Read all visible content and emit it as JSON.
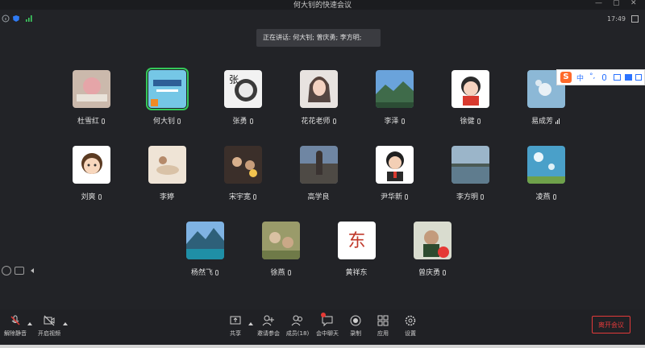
{
  "window": {
    "title": "何大钊的快速会议"
  },
  "topbar": {
    "time": "17:49"
  },
  "speaking": {
    "text": "正在讲话: 何大钊; 曾庆勇; 李方明;"
  },
  "ime": {
    "logo": "S",
    "mode": "中",
    "punct": "°,"
  },
  "participants": [
    {
      "name": "杜雪红"
    },
    {
      "name": "何大钊"
    },
    {
      "name": "张勇"
    },
    {
      "name": "花花老师"
    },
    {
      "name": "李泽"
    },
    {
      "name": "徐健"
    },
    {
      "name": "易成芳"
    },
    {
      "name": "刘爽"
    },
    {
      "name": "李婷"
    },
    {
      "name": "宋宇宽"
    },
    {
      "name": "高学良"
    },
    {
      "name": "尹华新"
    },
    {
      "name": "李方明"
    },
    {
      "name": "凌燕"
    },
    {
      "name": "杨然飞"
    },
    {
      "name": "徐燕"
    },
    {
      "name": "黄祥东"
    },
    {
      "name": "曾庆勇"
    }
  ],
  "avatars": {
    "zhang_char": "张",
    "huang_char": "东"
  },
  "toolbar": {
    "unmute": "解除静音",
    "video": "开启视频",
    "share": "共享",
    "invite": "邀请参会",
    "members": "成员(18)",
    "chat": "会中聊天",
    "record": "录制",
    "apps": "应用",
    "settings": "设置",
    "leave": "离开会议"
  },
  "colors": {
    "background": "#222327",
    "active_border": "#34c759",
    "leave_red": "#e23a3a"
  }
}
